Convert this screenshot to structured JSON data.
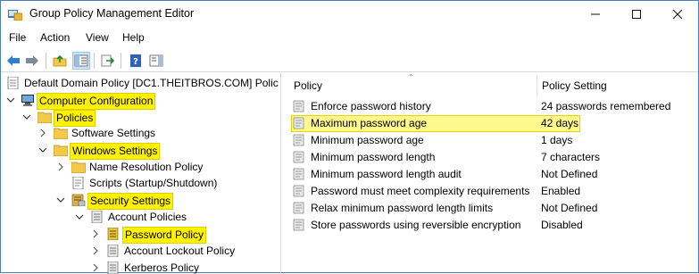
{
  "window": {
    "title": "Group Policy Management Editor"
  },
  "menu": [
    "File",
    "Action",
    "View",
    "Help"
  ],
  "toolbar": {
    "buttons": [
      "back-icon",
      "forward-icon",
      "up-folder-icon",
      "show-hide-tree-icon",
      "export-list-icon",
      "help-icon",
      "properties-pane-icon"
    ]
  },
  "tree": {
    "root": "Default Domain Policy [DC1.THEITBROS.COM] Polic",
    "computer_configuration": "Computer Configuration",
    "policies": "Policies",
    "software_settings": "Software Settings",
    "windows_settings": "Windows Settings",
    "name_resolution_policy": "Name Resolution Policy",
    "scripts": "Scripts (Startup/Shutdown)",
    "security_settings": "Security Settings",
    "account_policies": "Account Policies",
    "password_policy": "Password Policy",
    "account_lockout_policy": "Account Lockout Policy",
    "kerberos_policy": "Kerberos Policy"
  },
  "list": {
    "columns": {
      "policy": "Policy",
      "setting": "Policy Setting"
    },
    "rows": [
      {
        "policy": "Enforce password history",
        "setting": "24 passwords remembered"
      },
      {
        "policy": "Maximum password age",
        "setting": "42 days"
      },
      {
        "policy": "Minimum password age",
        "setting": "1 days"
      },
      {
        "policy": "Minimum password length",
        "setting": "7 characters"
      },
      {
        "policy": "Minimum password length audit",
        "setting": "Not Defined"
      },
      {
        "policy": "Password must meet complexity requirements",
        "setting": "Enabled"
      },
      {
        "policy": "Relax minimum password length limits",
        "setting": "Not Defined"
      },
      {
        "policy": "Store passwords using reversible encryption",
        "setting": "Disabled"
      }
    ]
  },
  "colors": {
    "highlight_yellow": "#fff200",
    "row_highlight": "#fff88c",
    "folder_yellow": "#f3c94b"
  }
}
